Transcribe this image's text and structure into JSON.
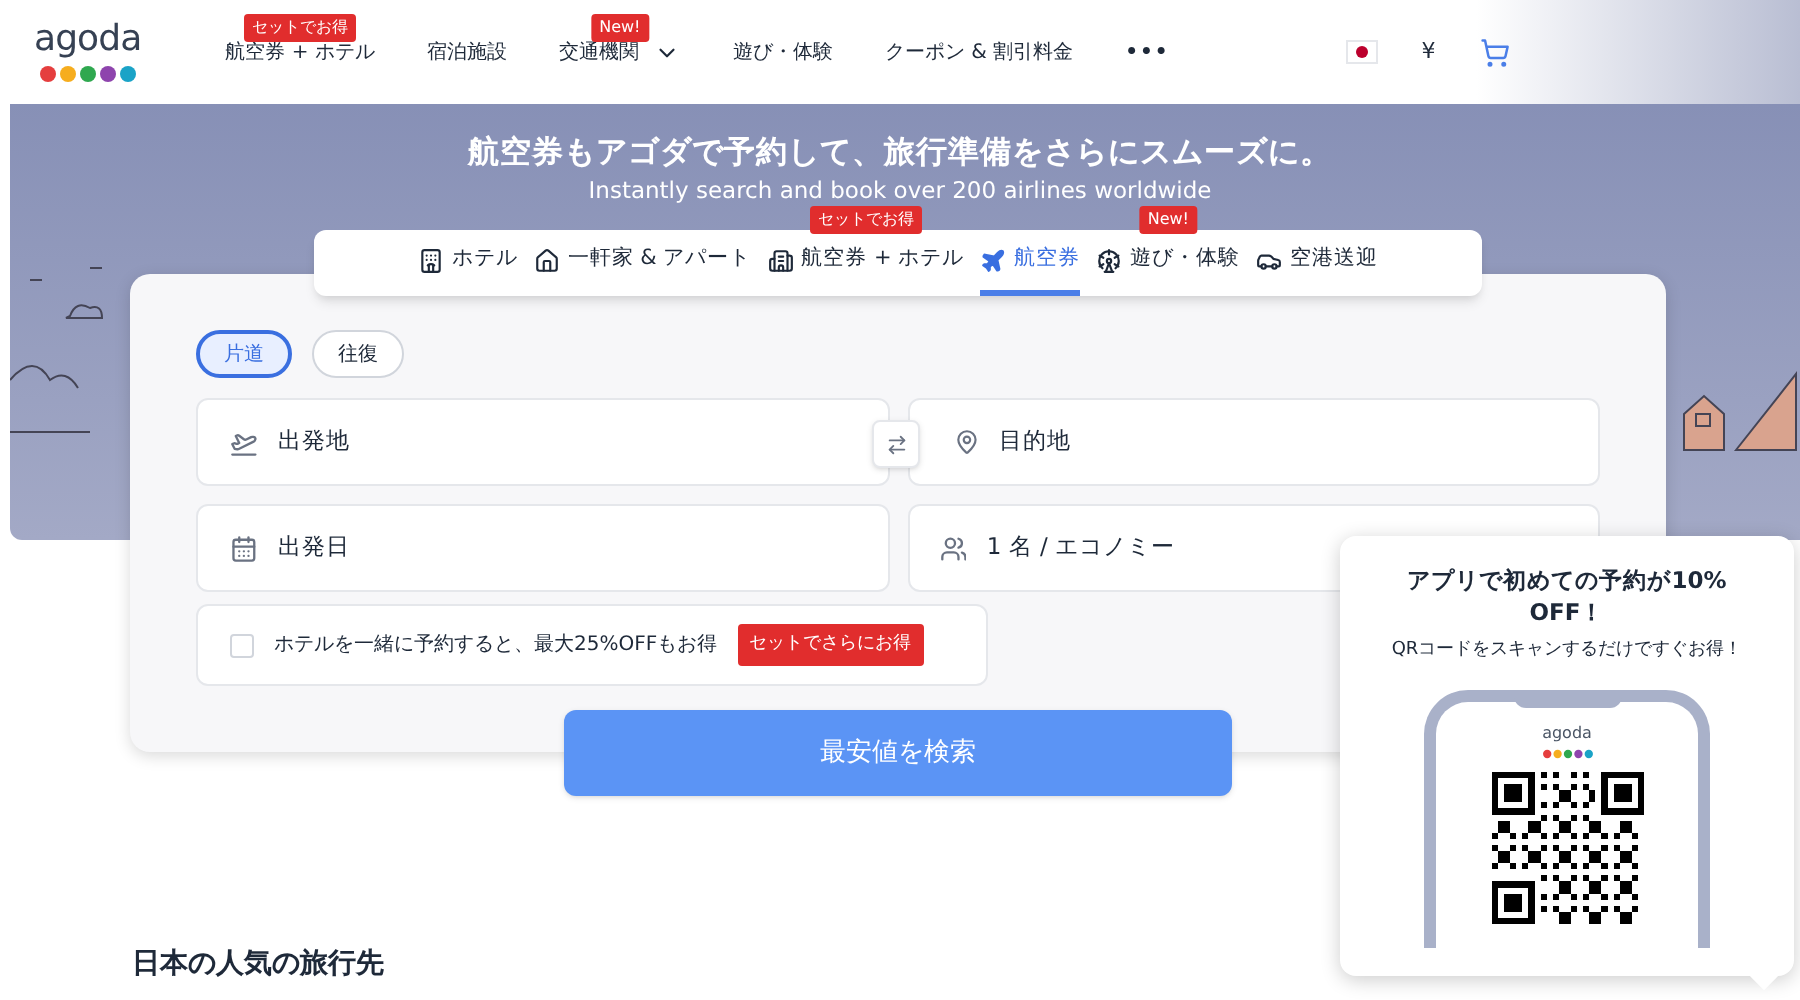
{
  "header": {
    "logo": "agoda",
    "nav": [
      {
        "label": "航空券 + ホテル",
        "badge": "セットでお得",
        "dropdown": false
      },
      {
        "label": "宿泊施設",
        "dropdown": false
      },
      {
        "label": "交通機関",
        "badge": "New!",
        "dropdown": true
      },
      {
        "label": "遊び・体験",
        "dropdown": false
      },
      {
        "label": "クーポン & 割引料金",
        "dropdown": false
      }
    ],
    "more": "•••",
    "currency": "¥"
  },
  "hero": {
    "title": "航空券もアゴダで予約して、旅行準備をさらにスムーズに。",
    "subtitle": "Instantly search and book over 200 airlines worldwide"
  },
  "tabs": [
    {
      "label": "ホテル",
      "selected": false
    },
    {
      "label": "一軒家 & アパート",
      "selected": false
    },
    {
      "label": "航空券 + ホテル",
      "selected": false,
      "badge": "セットでお得"
    },
    {
      "label": "航空券",
      "selected": true
    },
    {
      "label": "遊び・体験",
      "selected": false,
      "badge": "New!"
    },
    {
      "label": "空港送迎",
      "selected": false
    }
  ],
  "trip_types": [
    {
      "label": "片道",
      "selected": true
    },
    {
      "label": "往復",
      "selected": false
    }
  ],
  "fields": {
    "origin": {
      "placeholder": "出発地"
    },
    "destination": {
      "placeholder": "目的地"
    },
    "date": {
      "placeholder": "出発日"
    },
    "passengers": {
      "value": "1 名 / エコノミー"
    }
  },
  "hotel_option": {
    "checked": false,
    "label": "ホテルを一緒に予約すると、最大25%OFFもお得",
    "badge": "セットでさらにお得"
  },
  "search_button": "最安値を検索",
  "promo": {
    "title": "アプリで初めての予約が10% OFF！",
    "subtitle": "QRコードをスキャンするだけですぐお得！",
    "phone_logo": "agoda"
  },
  "section_title": "日本の人気の旅行先"
}
